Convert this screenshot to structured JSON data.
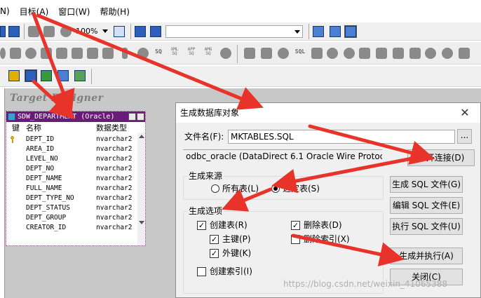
{
  "menu": {
    "items": [
      "N)",
      "目标(A)",
      "窗口(W)",
      "帮助(H)"
    ]
  },
  "toolbar": {
    "zoom": "100%",
    "row2_small_labels": [
      "SQ",
      "XML SQ",
      "APP SQ",
      "AMG SQ"
    ],
    "row2_labels_right": [
      "SQL"
    ]
  },
  "designer": {
    "title": "Target Designer"
  },
  "table_window": {
    "title": "SDW_DEPARTMENT (Oracle)",
    "columns": {
      "key": "键",
      "name": "名称",
      "type": "数据类型"
    },
    "rows": [
      {
        "name": "DEPT_ID",
        "type": "nvarchar2",
        "key": true
      },
      {
        "name": "AREA_ID",
        "type": "nvarchar2",
        "key": false
      },
      {
        "name": "LEVEL_NO",
        "type": "nvarchar2",
        "key": false
      },
      {
        "name": "DEPT_NO",
        "type": "nvarchar2",
        "key": false
      },
      {
        "name": "DEPT_NAME",
        "type": "nvarchar2",
        "key": false
      },
      {
        "name": "FULL_NAME",
        "type": "nvarchar2",
        "key": false
      },
      {
        "name": "DEPT_TYPE_NO",
        "type": "nvarchar2",
        "key": false
      },
      {
        "name": "DEPT_STATUS",
        "type": "nvarchar2",
        "key": false
      },
      {
        "name": "DEPT_GROUP",
        "type": "nvarchar2",
        "key": false
      },
      {
        "name": "CREATOR_ID",
        "type": "nvarchar2",
        "key": false
      }
    ]
  },
  "dialog": {
    "title": "生成数据库对象",
    "close": "✕",
    "filename_label": "文件名(F):",
    "filename_value": "MKTABLES.SQL",
    "browse": "...",
    "connection": "odbc_oracle (DataDirect 6.1 Oracle Wire Protocol)",
    "connect_button": "打开连接(D)",
    "source_group": "生成来源",
    "source_all": "所有表(L)",
    "source_selected": "选定表(S)",
    "options_group": "生成选项",
    "opt_create_table": "创建表(R)",
    "opt_primary_key": "主键(P)",
    "opt_foreign_key": "外键(K)",
    "opt_create_index": "创建索引(I)",
    "opt_drop_table": "删除表(D)",
    "opt_drop_index": "删除索引(X)",
    "btn_gen_sql": "生成 SQL 文件(G)",
    "btn_edit_sql": "编辑 SQL 文件(E)",
    "btn_exec_sql": "执行 SQL 文件(U)",
    "btn_gen_exec": "生成并执行(A)",
    "btn_close": "关闭(C)"
  },
  "watermark": "https://blog.csdn.net/weixin_41065388",
  "colors": {
    "arrow": "#e8332a",
    "table_title_bg": "#6a1b7a",
    "designer_bg": "#c8c8c8",
    "dialog_bg": "#f0f0f0"
  }
}
